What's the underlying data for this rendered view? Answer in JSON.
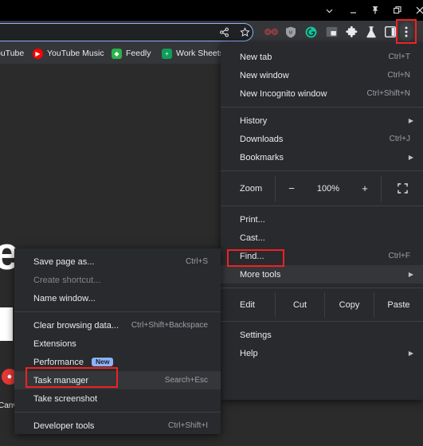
{
  "window_controls": [
    {
      "name": "chevron-down-icon",
      "label": "v"
    },
    {
      "name": "minimize-icon",
      "label": "_"
    },
    {
      "name": "pin-icon",
      "label": "pin"
    },
    {
      "name": "restore-icon",
      "label": "restore"
    },
    {
      "name": "close-icon",
      "label": "X"
    }
  ],
  "toolbar": {
    "share_icon": "share-icon",
    "bookmark_icon": "star-icon",
    "extensions": [
      {
        "name": "glasses-extension-icon",
        "glyph": "oo",
        "color": "#3c4043"
      },
      {
        "name": "shield-extension-icon",
        "glyph": "U",
        "color": "#9aa0a6"
      },
      {
        "name": "grammarly-extension-icon",
        "glyph": "G",
        "color": "#15c39a"
      },
      {
        "name": "picture-in-picture-icon",
        "glyph": "PiP",
        "color": "#3c4043"
      },
      {
        "name": "puzzle-extensions-icon",
        "glyph": "*",
        "color": "transparent"
      },
      {
        "name": "flask-labs-icon",
        "glyph": "flask",
        "color": "transparent"
      },
      {
        "name": "side-panel-icon",
        "glyph": "panel",
        "color": "transparent"
      },
      {
        "name": "kebab-menu-icon",
        "glyph": "kebab",
        "color": "#3c4043"
      }
    ]
  },
  "bookmarks": [
    {
      "label": "ouTube",
      "icon": "youtube-icon",
      "color": "#ff0000"
    },
    {
      "label": "YouTube Music",
      "icon": "youtube-music-icon",
      "color": "#ff0000"
    },
    {
      "label": "Feedly",
      "icon": "feedly-icon",
      "color": "#2bb24c"
    },
    {
      "label": "Work Sheets",
      "icon": "sheets-icon",
      "color": "#0f9d58"
    }
  ],
  "page": {
    "letter": "e",
    "red_badge_icon": "canva-avatar-icon",
    "partial_label": "Canv"
  },
  "main_menu": {
    "items": [
      {
        "label": "New tab",
        "shortcut": "Ctrl+T",
        "arrow": false,
        "disabled": false,
        "highlight": false
      },
      {
        "label": "New window",
        "shortcut": "Ctrl+N",
        "arrow": false,
        "disabled": false,
        "highlight": false
      },
      {
        "label": "New Incognito window",
        "shortcut": "Ctrl+Shift+N",
        "arrow": false,
        "disabled": false,
        "highlight": false
      },
      {
        "separator": true
      },
      {
        "label": "History",
        "shortcut": "",
        "arrow": true,
        "disabled": false,
        "highlight": false
      },
      {
        "label": "Downloads",
        "shortcut": "Ctrl+J",
        "arrow": false,
        "disabled": false,
        "highlight": false
      },
      {
        "label": "Bookmarks",
        "shortcut": "",
        "arrow": true,
        "disabled": false,
        "highlight": false
      },
      {
        "separator": true
      }
    ],
    "zoom_row": {
      "label": "Zoom",
      "minus": "−",
      "value": "100%",
      "plus": "+",
      "fullscreen_icon": "fullscreen-icon"
    },
    "items2": [
      {
        "label": "Print...",
        "shortcut": "",
        "arrow": false,
        "disabled": false,
        "highlight": false
      },
      {
        "label": "Cast...",
        "shortcut": "",
        "arrow": false,
        "disabled": false,
        "highlight": false
      },
      {
        "label": "Find...",
        "shortcut": "Ctrl+F",
        "arrow": false,
        "disabled": false,
        "highlight": false
      },
      {
        "label": "More tools",
        "shortcut": "",
        "arrow": true,
        "disabled": false,
        "highlight": true
      },
      {
        "separator": true
      }
    ],
    "edit_row": {
      "label": "Edit",
      "cut": "Cut",
      "copy": "Copy",
      "paste": "Paste"
    },
    "items3": [
      {
        "separator": true
      },
      {
        "label": "Settings",
        "shortcut": "",
        "arrow": false,
        "disabled": false,
        "highlight": false
      },
      {
        "label": "Help",
        "shortcut": "",
        "arrow": true,
        "disabled": false,
        "highlight": false
      }
    ]
  },
  "sub_menu": {
    "items": [
      {
        "label": "Save page as...",
        "shortcut": "Ctrl+S",
        "badge": "",
        "disabled": false,
        "highlight": false
      },
      {
        "label": "Create shortcut...",
        "shortcut": "",
        "badge": "",
        "disabled": true,
        "highlight": false
      },
      {
        "label": "Name window...",
        "shortcut": "",
        "badge": "",
        "disabled": false,
        "highlight": false
      },
      {
        "separator": true
      },
      {
        "label": "Clear browsing data...",
        "shortcut": "Ctrl+Shift+Backspace",
        "badge": "",
        "disabled": false,
        "highlight": false
      },
      {
        "label": "Extensions",
        "shortcut": "",
        "badge": "",
        "disabled": false,
        "highlight": false
      },
      {
        "label": "Performance",
        "shortcut": "",
        "badge": "New",
        "disabled": false,
        "highlight": false
      },
      {
        "label": "Task manager",
        "shortcut": "Search+Esc",
        "badge": "",
        "disabled": false,
        "highlight": true
      },
      {
        "label": "Take screenshot",
        "shortcut": "",
        "badge": "",
        "disabled": false,
        "highlight": false
      },
      {
        "separator": true
      },
      {
        "label": "Developer tools",
        "shortcut": "Ctrl+Shift+I",
        "badge": "",
        "disabled": false,
        "highlight": false
      }
    ]
  },
  "annotations": {
    "accent_color": "#ee2222",
    "boxes": [
      "kebab-menu-icon",
      "more-tools-item",
      "task-manager-item"
    ]
  }
}
